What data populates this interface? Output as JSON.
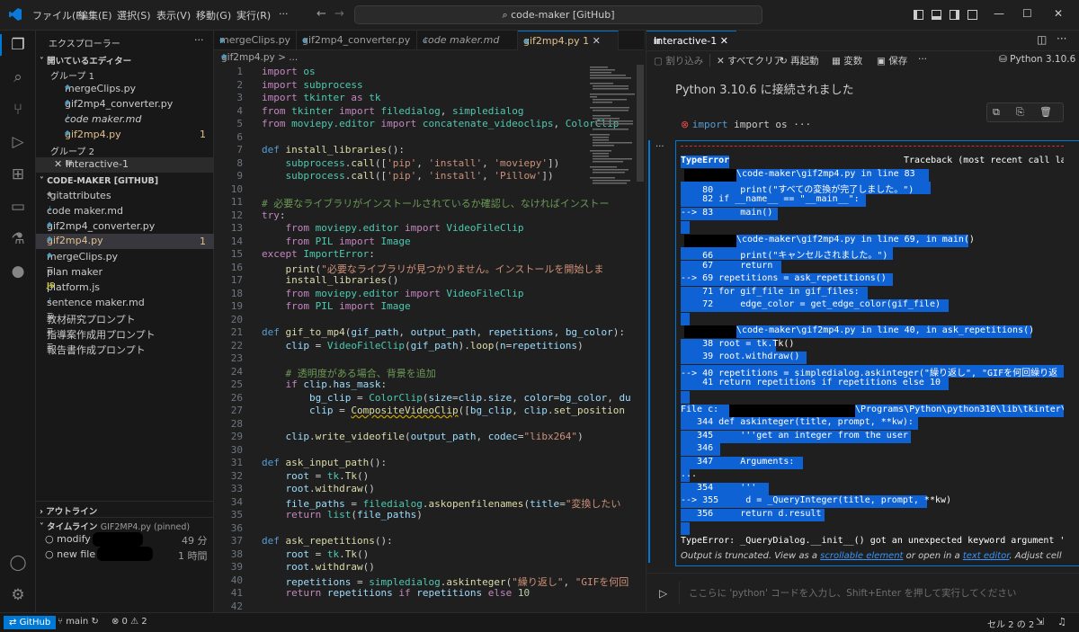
{
  "titlebar": {
    "menus": [
      "ファイル(F)",
      "編集(E)",
      "選択(S)",
      "表示(V)",
      "移動(G)",
      "実行(R)",
      "···"
    ],
    "command_center": "code-maker [GitHub]"
  },
  "explorer": {
    "title": "エクスプローラー",
    "open_editors": "開いているエディター",
    "group1": "グループ 1",
    "g1_files": [
      "mergeClips.py",
      "gif2mp4_converter.py",
      "code maker.md",
      "gif2mp4.py"
    ],
    "g1_badge": "1",
    "group2": "グループ 2",
    "g2_files": [
      "Interactive-1"
    ],
    "workspace": "CODE-MAKER [GITHUB]",
    "files": [
      ".gitattributes",
      "code maker.md",
      "gif2mp4_converter.py",
      "gif2mp4.py",
      "mergeClips.py",
      "plan maker",
      "platform.js",
      "sentence maker.md",
      "教材研究プロンプト",
      "指導案作成用プロンプト",
      "報告書作成プロンプト"
    ],
    "file_badge": "1",
    "outline": "アウトライン",
    "timeline": "タイムライン",
    "timeline_file": "GIF2MP4.py (pinned)",
    "timeline_items": [
      {
        "label": "modify",
        "time": "49 分"
      },
      {
        "label": "new file",
        "time": "1 時間"
      }
    ]
  },
  "tabs": [
    "mergeClips.py",
    "gif2mp4_converter.py",
    "code maker.md",
    "gif2mp4.py",
    "1"
  ],
  "breadcrumb": "gif2mp4.py > ...",
  "editor": {
    "line_numbers": [
      "1",
      "2",
      "3",
      "4",
      "5",
      "6",
      "7",
      "8",
      "9",
      "10",
      "11",
      "12",
      "13",
      "14",
      "15",
      "16",
      "17",
      "18",
      "19",
      "20",
      "21",
      "22",
      "23",
      "24",
      "25",
      "26",
      "27",
      "28",
      "29",
      "30",
      "31",
      "32",
      "33",
      "34",
      "35",
      "36",
      "37",
      "38",
      "39",
      "40",
      "41",
      "42"
    ]
  },
  "panel": {
    "tab": "Interactive-1",
    "toolbar": [
      "割り込み",
      "すべてクリア",
      "再起動",
      "変数",
      "保存",
      "···"
    ],
    "kernel": "Python 3.10.6",
    "connected": "Python 3.10.6 に接続されました",
    "cell_code": "import os ···",
    "ellipsis": "···"
  },
  "traceback": {
    "type_label": "TypeError",
    "header": "Traceback (most recent call la",
    "lines": [
      "\\code-maker\\gif2mp4.py in line 83",
      "    80     print(\"すべての変換が完了しました。\")",
      "    82 if __name__ == \"__main__\":",
      "--> 83     main()",
      "\\code-maker\\gif2mp4.py in line 69, in main()",
      "    66     print(\"キャンセルされました。\")",
      "    67     return",
      "--> 69 repetitions = ask_repetitions()",
      "    71 for gif_file in gif_files:",
      "    72     edge_color = get_edge_color(gif_file)",
      "\\code-maker\\gif2mp4.py in line 40, in ask_repetitions()",
      "    38 root = tk.Tk()",
      "    39 root.withdraw()",
      "--> 40 repetitions = simpledialog.askinteger(\"繰り返し\", \"GIFを何回繰り返",
      "    41 return repetitions if repetitions else 10",
      "File c:",
      "\\Programs\\Python\\python310\\lib\\tkinter\\",
      "   344 def askinteger(title, prompt, **kw):",
      "   345     '''get an integer from the user",
      "   346",
      "   347     Arguments:",
      "...",
      "   354     '''",
      "--> 355     d = _QueryInteger(title, prompt, **kw)",
      "   356     return d.result",
      "TypeError: _QueryDialog.__init__() got an unexpected keyword argument 'de"
    ],
    "truncated_pre": "Output is truncated. View as a ",
    "truncated_link1": "scrollable element",
    "truncated_mid": " or open in a ",
    "truncated_link2": "text editor",
    "truncated_post": ". Adjust cell output s"
  },
  "input": {
    "placeholder": "ここらに 'python' コードを入力し、Shift+Enter を押して実行してください"
  },
  "statusbar": {
    "remote": "GitHub",
    "branch": "main",
    "problems": "⊗ 0 ⚠ 2",
    "cell": "セル 2 の 2"
  }
}
